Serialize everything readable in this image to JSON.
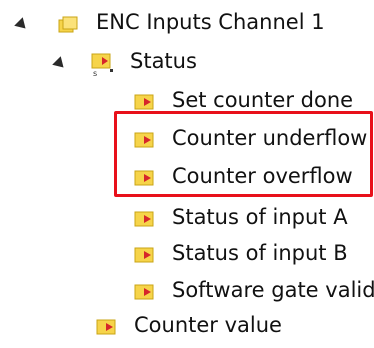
{
  "tree": {
    "channel": {
      "label": "ENC Inputs Channel 1",
      "icon": "folder-channel-icon"
    },
    "status_group": {
      "label": "Status",
      "icon": "status-group-icon"
    },
    "items": [
      {
        "label": "Set counter done",
        "icon": "input-variable-icon"
      },
      {
        "label": "Counter underflow",
        "icon": "input-variable-icon"
      },
      {
        "label": "Counter overflow",
        "icon": "input-variable-icon"
      },
      {
        "label": "Status of input A",
        "icon": "input-variable-icon"
      },
      {
        "label": "Status of input B",
        "icon": "input-variable-icon"
      },
      {
        "label": "Software gate valid",
        "icon": "input-variable-icon"
      }
    ],
    "counter_value": {
      "label": "Counter value",
      "icon": "input-variable-icon"
    }
  },
  "colors": {
    "highlight": "#e8101a",
    "folder_yellow": "#f6d44a",
    "arrow_red": "#d6262a"
  }
}
